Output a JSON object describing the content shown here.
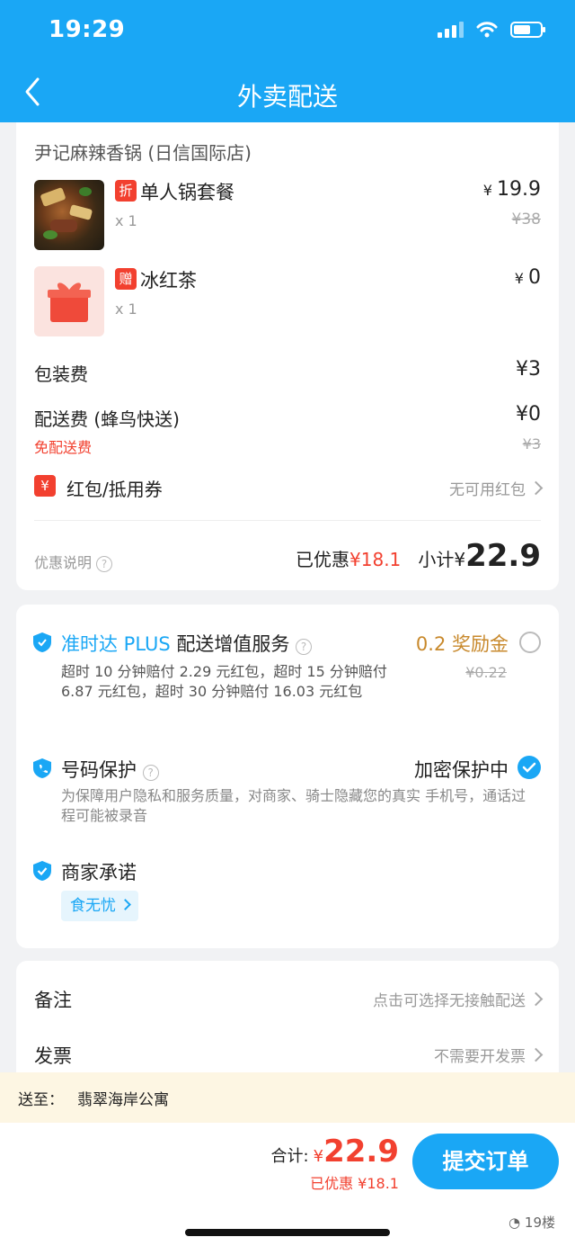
{
  "status_bar": {
    "time": "19:29"
  },
  "header": {
    "title": "外卖配送"
  },
  "order": {
    "shop_name": "尹记麻辣香锅 (日信国际店)",
    "items": [
      {
        "badge": "折",
        "name": "单人锅套餐",
        "qty": "x 1",
        "price": "19.9",
        "original": "¥38"
      },
      {
        "badge": "赠",
        "name": "冰红茶",
        "qty": "x 1",
        "price": "0"
      }
    ],
    "packing_fee": {
      "label": "包装费",
      "value": "¥3"
    },
    "delivery_fee": {
      "label": "配送费 (蜂鸟快送)",
      "value": "¥0",
      "note": "免配送费",
      "original": "¥3"
    },
    "coupon": {
      "badge": "¥",
      "label": "红包/抵用券",
      "value": "无可用红包"
    },
    "discount_info": "优惠说明",
    "saved_label": "已优惠",
    "saved_value": "¥18.1",
    "subtotal_label": "小计",
    "subtotal_currency": "¥",
    "subtotal_value": "22.9"
  },
  "services": {
    "ontime": {
      "brand": "准时达 PLUS",
      "title": "配送增值服务",
      "reward": "0.2 奖励金",
      "reward_original": "¥0.22",
      "desc": "超时 10 分钟赔付 2.29 元红包，超时 15 分钟赔付 6.87 元红包，超时 30 分钟赔付 16.03 元红包"
    },
    "privacy": {
      "title": "号码保护",
      "status": "加密保护中",
      "desc": "为保障用户隐私和服务质量，对商家、骑士隐藏您的真实 手机号，通话过程可能被录音"
    },
    "promise": {
      "title": "商家承诺",
      "tag": "食无忧"
    }
  },
  "extras": {
    "note": {
      "label": "备注",
      "value": "点击可选择无接触配送"
    },
    "invoice": {
      "label": "发票",
      "value": "不需要开发票"
    }
  },
  "address": {
    "label": "送至：",
    "value": "翡翠海岸公寓"
  },
  "footer": {
    "total_label": "合计:",
    "currency": "¥",
    "total_value": "22.9",
    "saved": "已优惠 ¥18.1",
    "submit": "提交订单",
    "watermark": "19楼"
  },
  "colors": {
    "primary": "#1aa7f5",
    "accent_red": "#f2402f",
    "reward_orange": "#c8892c"
  }
}
